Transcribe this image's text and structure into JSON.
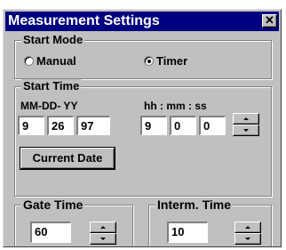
{
  "window": {
    "title": "Measurement Settings",
    "close_icon": "close-icon"
  },
  "start_mode": {
    "label": "Start Mode",
    "options": [
      {
        "label": "Manual",
        "selected": false
      },
      {
        "label": "Timer",
        "selected": true
      }
    ]
  },
  "start_time": {
    "label": "Start Time",
    "date_header": "MM-DD- YY",
    "time_header": "hh :  mm : ss",
    "month": "9",
    "day": "26",
    "year": "97",
    "hour": "9",
    "minute": "0",
    "second": "0",
    "current_date_button": "Current Date"
  },
  "gate_time": {
    "label": "Gate Time",
    "value": "60"
  },
  "interm_time": {
    "label": "Interm. Time",
    "value": "10"
  },
  "colors": {
    "title_bar": "#000080",
    "face": "#c0c0c0"
  }
}
